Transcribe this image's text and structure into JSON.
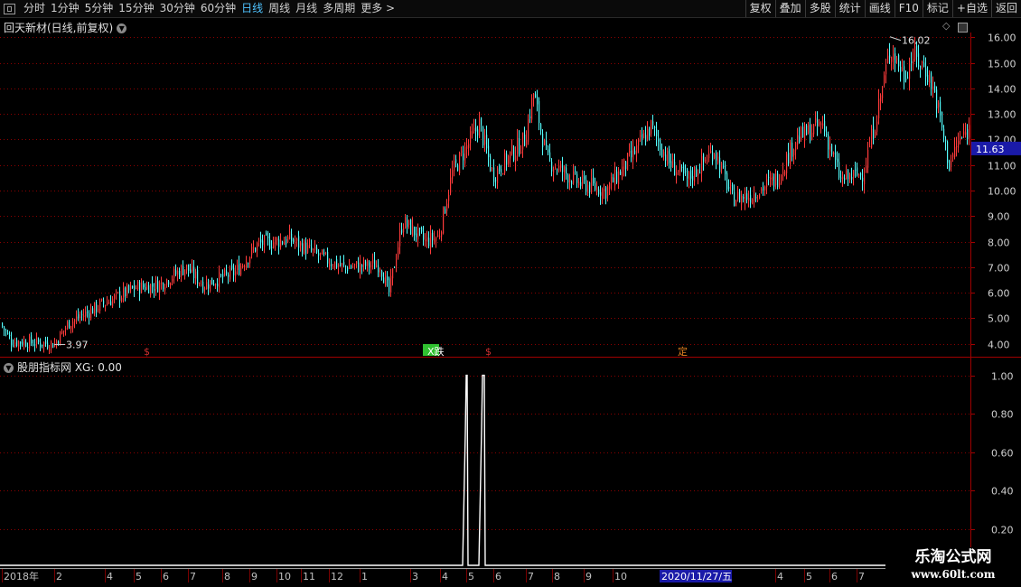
{
  "toolbar": {
    "periods": [
      "分时",
      "1分钟",
      "5分钟",
      "15分钟",
      "30分钟",
      "60分钟",
      "日线",
      "周线",
      "月线",
      "多周期",
      "更多 >"
    ],
    "active": "日线",
    "right_buttons": [
      "复权",
      "叠加",
      "多股",
      "统计",
      "画线",
      "F10",
      "标记",
      "+自选",
      "返回"
    ]
  },
  "main_chart": {
    "title": "回天新材(日线,前复权)",
    "high_label": "16.02",
    "low_label": "3.97",
    "current_price": "11.63",
    "y_ticks": [
      "16.00",
      "15.00",
      "14.00",
      "13.00",
      "12.00",
      "11.00",
      "10.00",
      "9.00",
      "8.00",
      "7.00",
      "6.00",
      "5.00",
      "4.00"
    ],
    "markers": [
      {
        "label": "$",
        "color": "#d03030"
      },
      {
        "label": "X跌",
        "color": "#30c030"
      },
      {
        "label": "$",
        "color": "#d03030"
      },
      {
        "label": "定",
        "color": "#e08020"
      }
    ]
  },
  "indicator": {
    "title": "股朋指标网 XG: 0.00",
    "y_ticks": [
      "1.00",
      "0.80",
      "0.60",
      "0.40",
      "0.20"
    ]
  },
  "x_axis": {
    "labels": [
      "2018年",
      "2",
      "4",
      "5",
      "6",
      "7",
      "8",
      "9",
      "10",
      "11",
      "12",
      "1",
      "3",
      "4",
      "5",
      "6",
      "7",
      "8",
      "9",
      "10",
      "4",
      "5",
      "6",
      "7"
    ],
    "cursor_date": "2020/11/27/五"
  },
  "watermark": {
    "line1": "乐淘公式网",
    "line2": "www.60lt.com"
  },
  "colors": {
    "up": "#ff3b3b",
    "down": "#54fcfc",
    "grid": "#8b0000",
    "axis": "#a00000"
  },
  "chart_data": [
    {
      "type": "candlestick",
      "title": "回天新材(日线,前复权)",
      "ylim": [
        3.6,
        16.4
      ],
      "anchors": [
        [
          0,
          4.8
        ],
        [
          12,
          4.1
        ],
        [
          60,
          4.0
        ],
        [
          75,
          4.8
        ],
        [
          110,
          5.5
        ],
        [
          150,
          6.2
        ],
        [
          175,
          6.3
        ],
        [
          205,
          7.0
        ],
        [
          225,
          6.3
        ],
        [
          260,
          6.8
        ],
        [
          285,
          7.9
        ],
        [
          320,
          8.1
        ],
        [
          360,
          7.3
        ],
        [
          380,
          7.0
        ],
        [
          420,
          7.1
        ],
        [
          430,
          6.0
        ],
        [
          445,
          8.8
        ],
        [
          470,
          8.0
        ],
        [
          485,
          8.2
        ],
        [
          500,
          10.7
        ],
        [
          530,
          12.6
        ],
        [
          545,
          10.6
        ],
        [
          580,
          12.0
        ],
        [
          590,
          13.8
        ],
        [
          605,
          11.2
        ],
        [
          640,
          10.3
        ],
        [
          670,
          10.0
        ],
        [
          700,
          11.4
        ],
        [
          720,
          12.5
        ],
        [
          740,
          11.1
        ],
        [
          760,
          10.4
        ],
        [
          790,
          11.6
        ],
        [
          810,
          9.7
        ],
        [
          830,
          9.8
        ],
        [
          860,
          10.5
        ],
        [
          880,
          12.0
        ],
        [
          910,
          12.6
        ],
        [
          930,
          10.4
        ],
        [
          955,
          10.7
        ],
        [
          970,
          13.0
        ],
        [
          985,
          15.6
        ],
        [
          1000,
          14.5
        ],
        [
          1010,
          15.3
        ],
        [
          1025,
          14.7
        ],
        [
          1035,
          13.7
        ],
        [
          1050,
          11.0
        ],
        [
          1060,
          11.9
        ],
        [
          1072,
          12.4
        ]
      ],
      "high": 16.02,
      "low": 3.97,
      "last": 11.63
    },
    {
      "type": "line",
      "title": "股朋指标网 XG: 0.00",
      "ylim": [
        0,
        1.05
      ],
      "signals": [
        0.5,
        0.58
      ],
      "values_note": "0 everywhere except two 1.00 pulses"
    }
  ]
}
